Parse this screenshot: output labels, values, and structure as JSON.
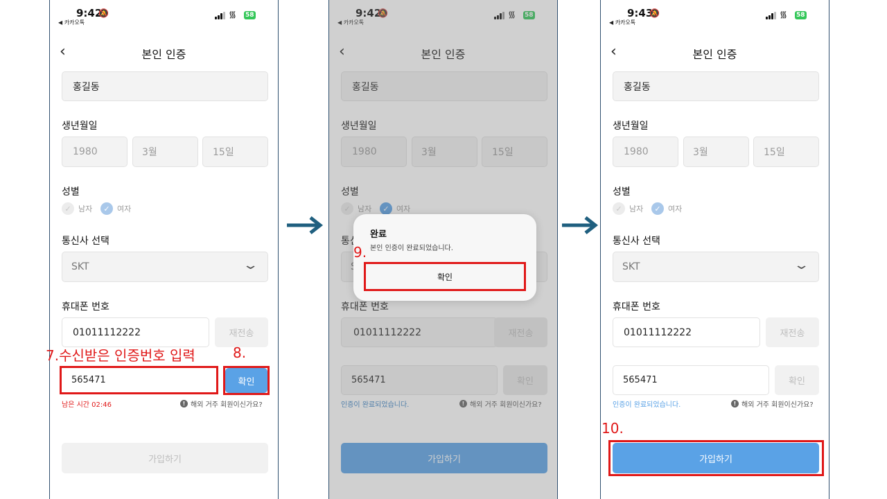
{
  "status": {
    "times": [
      "9:42",
      "9:42",
      "9:43"
    ],
    "back_app": "◀ 카카오톡",
    "battery": "58"
  },
  "header": {
    "title": "본인 인증"
  },
  "form": {
    "name": "홍길동",
    "birth_label": "생년월일",
    "birth_year": "1980",
    "birth_month": "3월",
    "birth_day": "15일",
    "gender_label": "성별",
    "gender_male": "남자",
    "gender_female": "여자",
    "carrier_label": "통신사 선택",
    "carrier_value": "SKT",
    "phone_label": "휴대폰 번호",
    "phone_value": "01011112222",
    "resend_label": "재전송",
    "code_value": "565471",
    "confirm_label": "확인",
    "timer_text": "남은 시간 02:46",
    "verified_text": "인증이 완료되었습니다.",
    "overseas_text": "해외 거주 회원이신가요?",
    "signup_label": "가입하기"
  },
  "dialog": {
    "title": "완료",
    "message": "본인 인증이 완료되었습니다.",
    "ok_label": "확인"
  },
  "annotations": {
    "step7": "7.수신받은 인증번호 입력",
    "step8": "8.",
    "step9": "9.",
    "step10": "10."
  },
  "colors": {
    "accent_blue": "#5aa2e6",
    "annotation_red": "#e01818",
    "arrow": "#1f5f7f"
  }
}
